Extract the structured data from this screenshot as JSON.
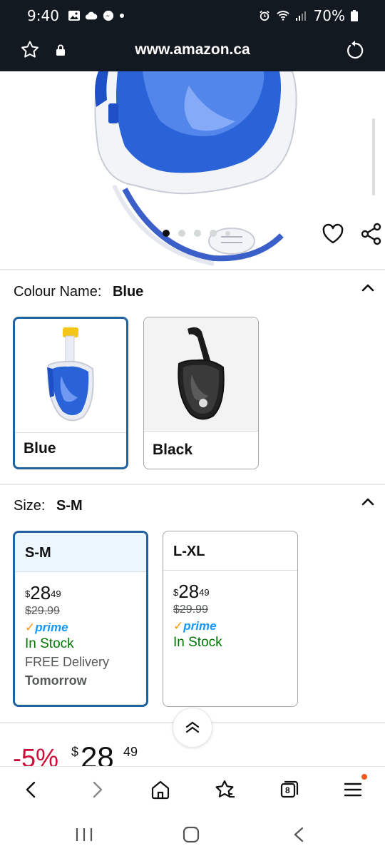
{
  "status_bar": {
    "time": "9:40",
    "battery": "70%"
  },
  "browser": {
    "url": "www.amazon.ca",
    "tab_count": "8"
  },
  "gallery": {
    "image_count": 5,
    "active_index": 0
  },
  "colour": {
    "label": "Colour Name:",
    "selected": "Blue",
    "options": [
      {
        "name": "Blue",
        "selected": true
      },
      {
        "name": "Black",
        "selected": false
      }
    ]
  },
  "size": {
    "label": "Size:",
    "selected": "S-M",
    "options": [
      {
        "name": "S-M",
        "dollar_sign": "$",
        "price_whole": "28",
        "price_cents": "49",
        "was": "$29.99",
        "prime": "prime",
        "stock": "In Stock",
        "delivery": "FREE Delivery",
        "delivery_day": "Tomorrow",
        "selected": true
      },
      {
        "name": "L-XL",
        "dollar_sign": "$",
        "price_whole": "28",
        "price_cents": "49",
        "was": "$29.99",
        "prime": "prime",
        "stock": "In Stock",
        "selected": false
      }
    ]
  },
  "price_banner": {
    "discount": "-5%",
    "dollar_sign": "$",
    "whole": "28",
    "cents": "49"
  },
  "colors": {
    "header_bg": "#131921",
    "selected_border": "#2162a1",
    "in_stock": "#007600",
    "prime_blue": "#1399ff",
    "discount_red": "#cc0c39",
    "menu_badge": "#f35b1d"
  }
}
